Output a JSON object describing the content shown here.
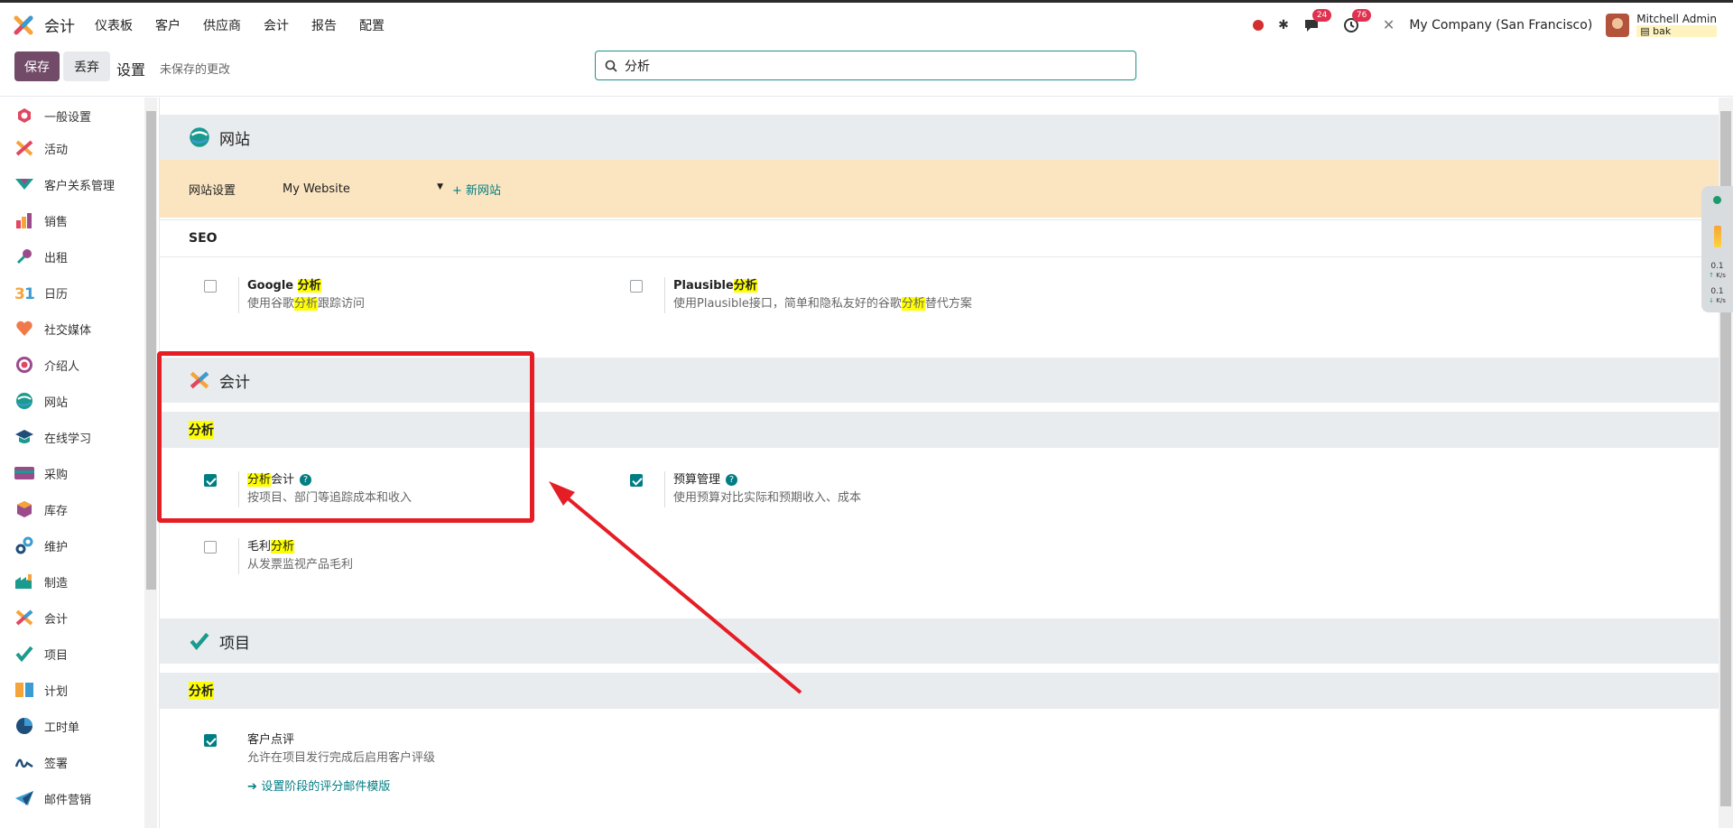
{
  "topbar": {
    "app_name": "会计",
    "menu": [
      "仪表板",
      "客户",
      "供应商",
      "会计",
      "报告",
      "配置"
    ],
    "messages_count": "24",
    "activities_count": "76",
    "company": "My Company (San Francisco)",
    "user_name": "Mitchell Admin",
    "database": "bak"
  },
  "control": {
    "save": "保存",
    "discard": "丢弃",
    "title": "设置",
    "unsaved": "未保存的更改",
    "search_value": "分析"
  },
  "sidebar": {
    "items": [
      {
        "label": "一般设置",
        "icon": "general-settings-icon"
      },
      {
        "label": "活动",
        "icon": "activity-icon"
      },
      {
        "label": "客户关系管理",
        "icon": "crm-icon"
      },
      {
        "label": "销售",
        "icon": "sales-icon"
      },
      {
        "label": "出租",
        "icon": "rental-icon"
      },
      {
        "label": "日历",
        "icon": "calendar-icon"
      },
      {
        "label": "社交媒体",
        "icon": "social-icon"
      },
      {
        "label": "介绍人",
        "icon": "referral-icon"
      },
      {
        "label": "网站",
        "icon": "website-icon"
      },
      {
        "label": "在线学习",
        "icon": "elearning-icon"
      },
      {
        "label": "采购",
        "icon": "purchase-icon"
      },
      {
        "label": "库存",
        "icon": "inventory-icon"
      },
      {
        "label": "维护",
        "icon": "maintenance-icon"
      },
      {
        "label": "制造",
        "icon": "manufacturing-icon"
      },
      {
        "label": "会计",
        "icon": "accounting-icon"
      },
      {
        "label": "项目",
        "icon": "project-icon"
      },
      {
        "label": "计划",
        "icon": "planning-icon"
      },
      {
        "label": "工时单",
        "icon": "timesheet-icon"
      },
      {
        "label": "签署",
        "icon": "sign-icon"
      },
      {
        "label": "邮件营销",
        "icon": "email-marketing-icon"
      }
    ]
  },
  "website": {
    "title": "网站",
    "settings_label": "网站设置",
    "selected_website": "My Website",
    "new_website": "+ 新网站",
    "seo_header": "SEO",
    "google": {
      "title_a": "Google ",
      "title_hl": "分析",
      "desc_a": "使用谷歌",
      "desc_hl": "分析",
      "desc_b": "跟踪访问",
      "checked": false
    },
    "plausible": {
      "title_a": "Plausible",
      "title_hl": "分析",
      "desc_a": "使用Plausible接口，简单和隐私友好的谷歌",
      "desc_hl": "分析",
      "desc_b": "替代方案",
      "checked": false
    }
  },
  "accounting": {
    "title": "会计",
    "section": "分析",
    "analytic": {
      "title_hl": "分析",
      "title_b": "会计",
      "desc": "按项目、部门等追踪成本和收入",
      "checked": true
    },
    "budget": {
      "title": "预算管理",
      "desc": "使用预算对比实际和预期收入、成本",
      "checked": true
    },
    "margin": {
      "title_a": "毛利",
      "title_hl": "分析",
      "desc": "从发票监视产品毛利",
      "checked": false
    }
  },
  "project": {
    "title": "项目",
    "section": "分析",
    "rating": {
      "title": "客户点评",
      "desc": "允许在项目发行完成后启用客户评级",
      "link": "设置阶段的评分邮件模版",
      "checked": true
    }
  },
  "widget": {
    "up_speed": "0.1",
    "up_unit": "K/s",
    "down_speed": "0.1",
    "down_unit": "K/s"
  },
  "colors": {
    "primary": "#714b67",
    "teal": "#017e84",
    "highlight": "#ffff00",
    "annotation": "#e51e25",
    "warning_bg": "#fbe5c1"
  }
}
